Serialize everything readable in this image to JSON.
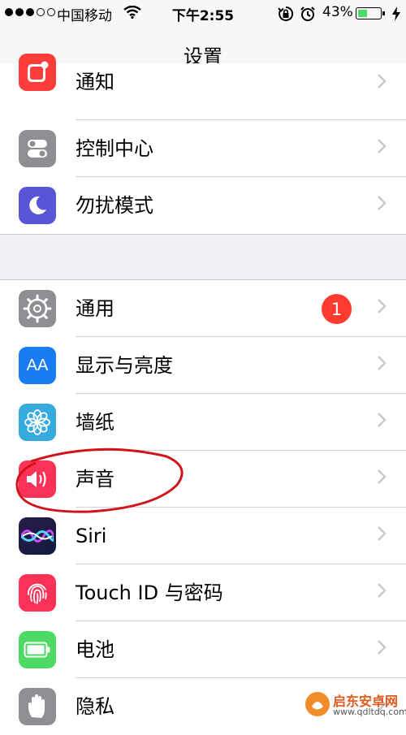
{
  "status_bar": {
    "carrier": "中国移动",
    "time": "下午2:55",
    "battery_percent": "43%",
    "battery_level": 0.43,
    "signal_filled": 3,
    "signal_total": 5
  },
  "nav": {
    "title": "设置"
  },
  "groups": [
    {
      "items": [
        {
          "label": "通知",
          "icon": "notifications-icon",
          "icon_color": "#fc3d39"
        },
        {
          "label": "控制中心",
          "icon": "control-center-icon",
          "icon_color": "#8e8e93"
        },
        {
          "label": "勿扰模式",
          "icon": "moon-icon",
          "icon_color": "#5856d6"
        }
      ]
    },
    {
      "items": [
        {
          "label": "通用",
          "icon": "gear-icon",
          "icon_color": "#8e8e93",
          "badge": "1"
        },
        {
          "label": "显示与亮度",
          "icon": "text-size-icon",
          "icon_color": "#1a7cf4",
          "icon_text": "AA"
        },
        {
          "label": "墙纸",
          "icon": "flower-icon",
          "icon_color": "#35aadc"
        },
        {
          "label": "声音",
          "icon": "speaker-icon",
          "icon_color": "#fc3158"
        },
        {
          "label": "Siri",
          "icon": "siri-icon",
          "icon_color": "#1d1d3a"
        },
        {
          "label": "Touch ID 与密码",
          "icon": "fingerprint-icon",
          "icon_color": "#fc3158"
        },
        {
          "label": "电池",
          "icon": "battery-icon",
          "icon_color": "#4cd964"
        },
        {
          "label": "隐私",
          "icon": "hand-icon",
          "icon_color": "#8e8e93"
        }
      ]
    }
  ],
  "watermark": {
    "text": "启东安卓网",
    "url": "www.qdltdq.com"
  },
  "colors": {
    "background": "#efeff4",
    "separator": "#c8c7cc",
    "badge": "#ff3b30",
    "annotation": "#d0141a"
  }
}
